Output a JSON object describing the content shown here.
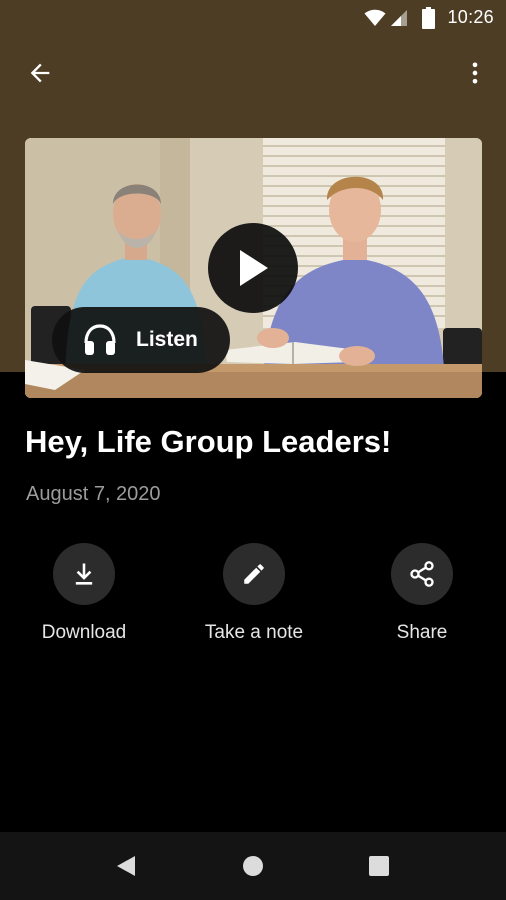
{
  "status_bar": {
    "time": "10:26",
    "icons": [
      "wifi-icon",
      "cell-signal-icon",
      "battery-icon"
    ]
  },
  "toolbar": {
    "back_icon": "arrow-back-icon",
    "menu_icon": "more-vert-icon"
  },
  "media": {
    "thumbnail": "video-thumbnail",
    "play_icon": "play-icon",
    "listen_label": "Listen",
    "listen_icon": "headphones-icon"
  },
  "content": {
    "title": "Hey, Life Group Leaders!",
    "date": "August 7, 2020"
  },
  "actions": [
    {
      "label": "Download",
      "icon": "download-icon"
    },
    {
      "label": "Take a note",
      "icon": "pencil-icon"
    },
    {
      "label": "Share",
      "icon": "share-icon"
    }
  ],
  "nav_bar": {
    "icons": [
      "nav-back-icon",
      "nav-home-icon",
      "nav-recents-icon"
    ]
  },
  "colors": {
    "header": "#4e3d25",
    "background": "#000000",
    "text_primary": "#ffffff",
    "text_secondary": "#9c9c9c",
    "action_circle": "#2c2c2c",
    "nav_bar": "#141414"
  }
}
